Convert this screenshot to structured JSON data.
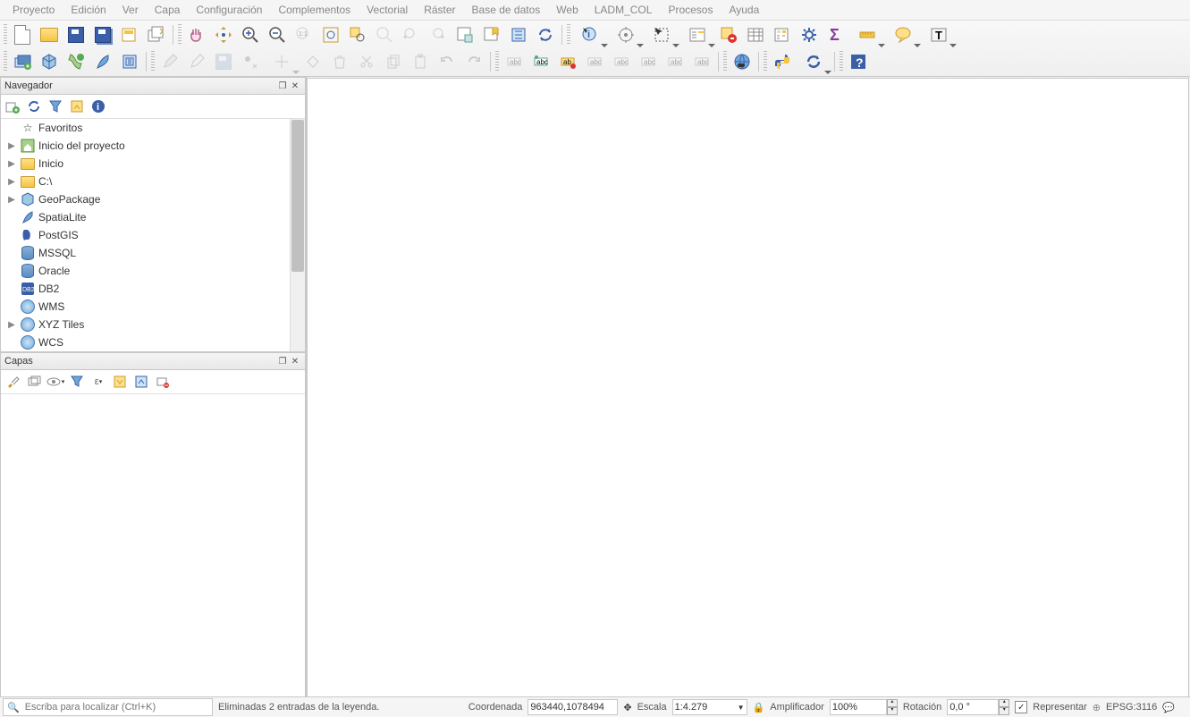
{
  "menu": [
    "Proyecto",
    "Edición",
    "Ver",
    "Capa",
    "Configuración",
    "Complementos",
    "Vectorial",
    "Ráster",
    "Base de datos",
    "Web",
    "LADM_COL",
    "Procesos",
    "Ayuda"
  ],
  "panels": {
    "navigator": {
      "title": "Navegador"
    },
    "layers": {
      "title": "Capas"
    }
  },
  "navigator_items": [
    {
      "label": "Favoritos",
      "icon": "star",
      "expandable": false
    },
    {
      "label": "Inicio del proyecto",
      "icon": "project-home",
      "expandable": true
    },
    {
      "label": "Inicio",
      "icon": "folder",
      "expandable": true
    },
    {
      "label": "C:\\",
      "icon": "folder",
      "expandable": true
    },
    {
      "label": "GeoPackage",
      "icon": "geopackage",
      "expandable": true
    },
    {
      "label": "SpatiaLite",
      "icon": "spatialite",
      "expandable": false
    },
    {
      "label": "PostGIS",
      "icon": "postgis",
      "expandable": false
    },
    {
      "label": "MSSQL",
      "icon": "mssql",
      "expandable": false
    },
    {
      "label": "Oracle",
      "icon": "oracle",
      "expandable": false
    },
    {
      "label": "DB2",
      "icon": "db2",
      "expandable": false
    },
    {
      "label": "WMS",
      "icon": "globe",
      "expandable": false
    },
    {
      "label": "XYZ Tiles",
      "icon": "globe",
      "expandable": true
    },
    {
      "label": "WCS",
      "icon": "globe",
      "expandable": false
    }
  ],
  "status": {
    "locator_placeholder": "Escriba para localizar (Ctrl+K)",
    "message": "Eliminadas 2 entradas de la leyenda.",
    "coord_label": "Coordenada",
    "coord_value": "963440,1078494",
    "scale_label": "Escala",
    "scale_value": "1:4.279",
    "magnifier_label": "Amplificador",
    "magnifier_value": "100%",
    "rotation_label": "Rotación",
    "rotation_value": "0,0 °",
    "render_label": "Representar",
    "crs_label": "EPSG:3116"
  },
  "colors": {
    "accent": "#3a5fa8",
    "folder": "#f5c542"
  }
}
